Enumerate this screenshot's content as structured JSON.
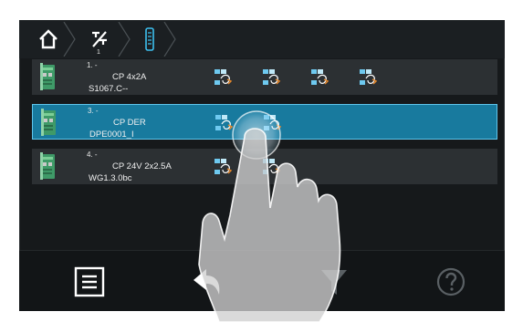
{
  "breadcrumb": {
    "home_icon": "home-icon",
    "station_icon": "no-signal-station-icon",
    "station_number": "1",
    "module_icon": "module-rack-icon"
  },
  "rows": [
    {
      "index": "1. -",
      "name": "CP 4x2A",
      "code": "S1067.C--",
      "selected": false,
      "channels": 4
    },
    {
      "index": "3. -",
      "name": "CP DER",
      "code": "DPE0001_I",
      "selected": true,
      "channels": 2
    },
    {
      "index": "4. -",
      "name": "CP 24V 2x2.5A",
      "code": "WG1.3.0bc",
      "selected": false,
      "channels": 2
    }
  ],
  "toolbar": {
    "menu_icon": "list-menu-icon",
    "back_icon": "back-arrow-icon",
    "filter_icon": "filter-icon",
    "help_icon": "help-icon"
  },
  "colors": {
    "background": "#16191b",
    "row": "#2c3033",
    "selected_row": "#187a9e",
    "selected_border": "#5fc6ec",
    "accent": "#3cc0f0",
    "channel_arrow": "#e8882a"
  }
}
